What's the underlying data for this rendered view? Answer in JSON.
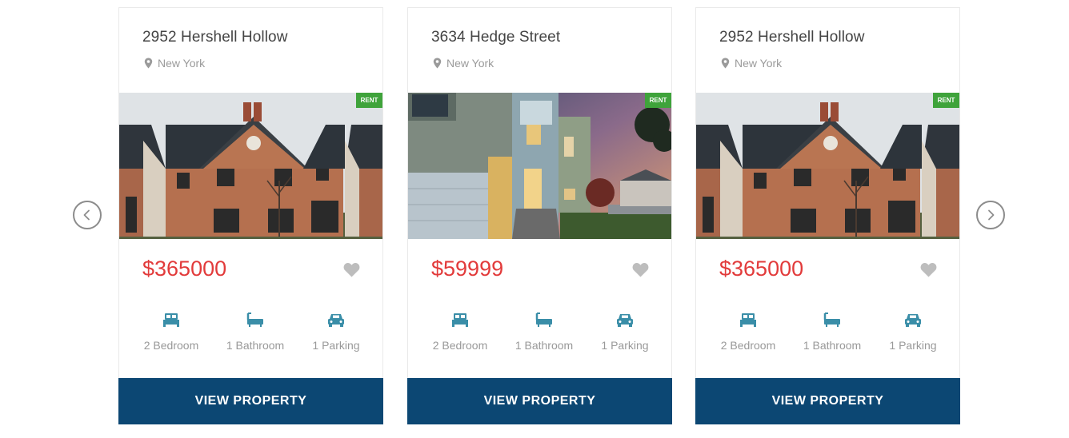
{
  "listings": [
    {
      "title": "2952 Hershell Hollow",
      "location": "New York",
      "badge": "RENT",
      "price": "$365000",
      "bedrooms": "2 Bedroom",
      "bathrooms": "1 Bathroom",
      "parking": "1 Parking",
      "button_label": "VIEW PROPERTY",
      "image": "brick-house-photo"
    },
    {
      "title": "3634 Hedge Street",
      "location": "New York",
      "badge": "RENT",
      "price": "$59999",
      "bedrooms": "2 Bedroom",
      "bathrooms": "1 Bathroom",
      "parking": "1 Parking",
      "button_label": "VIEW PROPERTY",
      "image": "modern-house-dusk-photo"
    },
    {
      "title": "2952 Hershell Hollow",
      "location": "New York",
      "badge": "RENT",
      "price": "$365000",
      "bedrooms": "2 Bedroom",
      "bathrooms": "1 Bathroom",
      "parking": "1 Parking",
      "button_label": "VIEW PROPERTY",
      "image": "brick-house-photo"
    }
  ],
  "carousel": {
    "prev_icon": "chevron-left-icon",
    "next_icon": "chevron-right-icon"
  },
  "colors": {
    "price": "#e23b3b",
    "button_bg": "#0c4773",
    "badge_bg": "#3fa33b",
    "feature_icon": "#3a8ea8",
    "favorite_icon": "#bdbdbd"
  }
}
